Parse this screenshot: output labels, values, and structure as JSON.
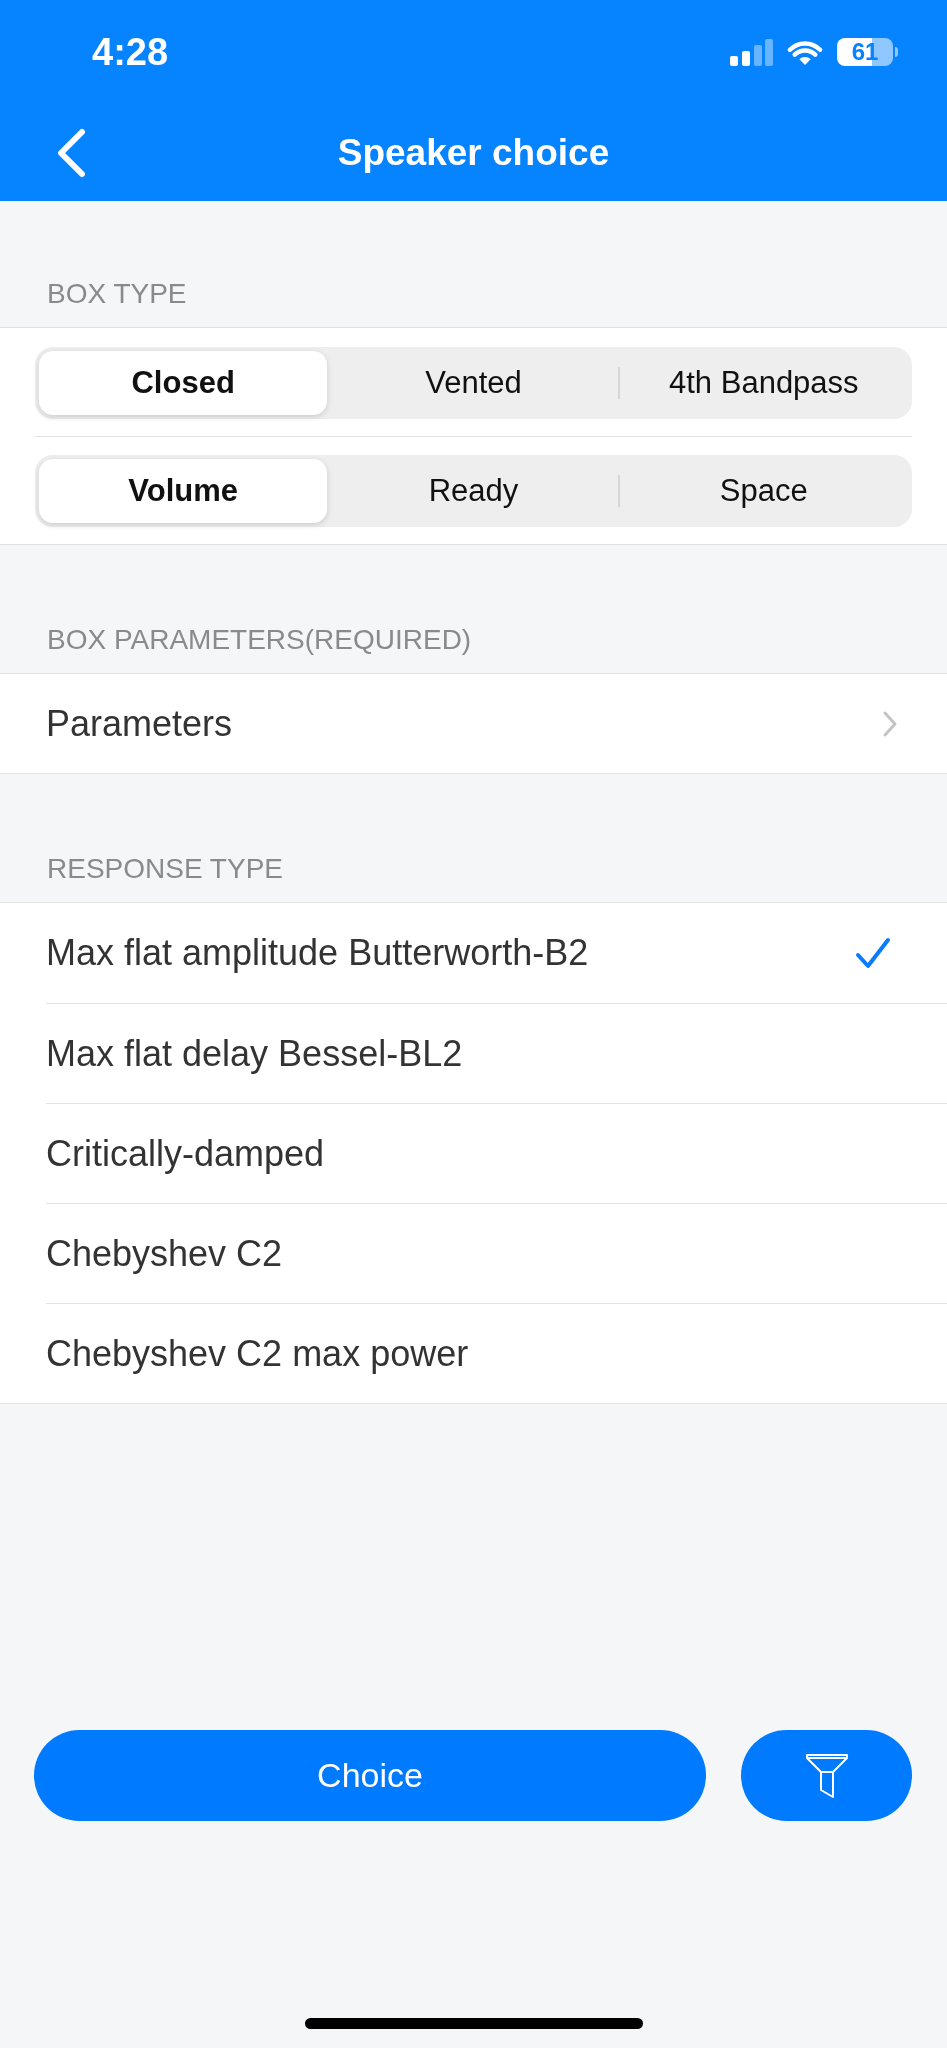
{
  "status_bar": {
    "time": "4:28",
    "battery": "61"
  },
  "navigation": {
    "title": "Speaker choice"
  },
  "sections": [
    {
      "kind": "segmented",
      "header": "BOX TYPE",
      "controls": [
        {
          "segments": [
            {
              "label": "Closed",
              "selected": true
            },
            {
              "label": "Vented",
              "selected": false
            },
            {
              "label": "4th Bandpass",
              "selected": false
            }
          ]
        },
        {
          "segments": [
            {
              "label": "Volume",
              "selected": true
            },
            {
              "label": "Ready",
              "selected": false
            },
            {
              "label": "Space",
              "selected": false
            }
          ]
        }
      ]
    },
    {
      "kind": "links",
      "header": "BOX PARAMETERS(REQUIRED)",
      "rows": [
        {
          "label": "Parameters"
        }
      ]
    },
    {
      "kind": "options",
      "header": "RESPONSE TYPE",
      "rows": [
        {
          "label": "Max flat amplitude Butterworth-B2",
          "selected": true
        },
        {
          "label": "Max flat delay Bessel-BL2",
          "selected": false
        },
        {
          "label": "Critically-damped",
          "selected": false
        },
        {
          "label": "Chebyshev C2",
          "selected": false
        },
        {
          "label": "Chebyshev C2 max power",
          "selected": false
        }
      ]
    }
  ],
  "actions": {
    "primary_button": "Choice"
  }
}
